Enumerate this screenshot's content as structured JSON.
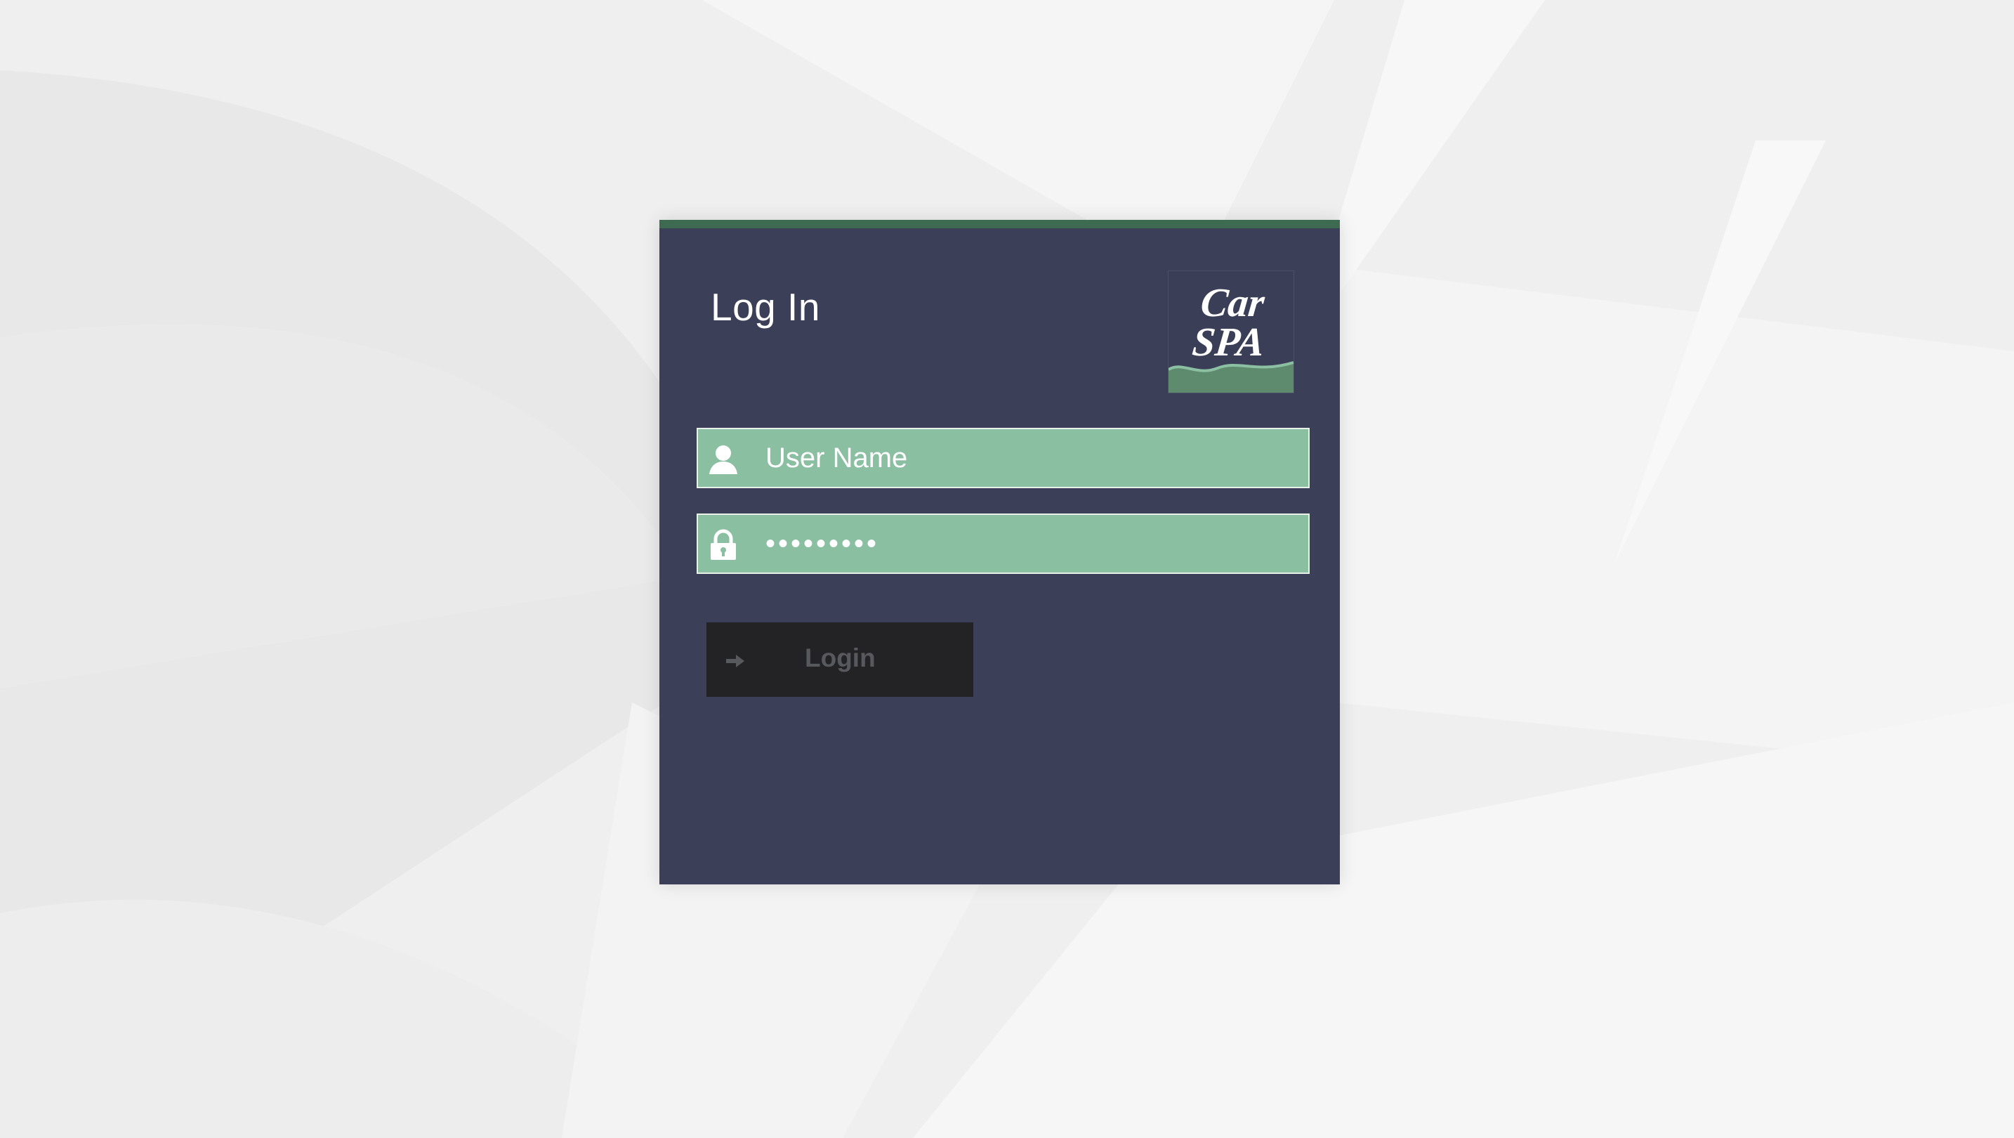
{
  "login_card": {
    "title": "Log In",
    "logo": {
      "line1": "Car",
      "line2": "SPA",
      "icon": "car-spa-logo"
    },
    "username": {
      "placeholder": "User Name",
      "value": "",
      "icon": "user-icon"
    },
    "password": {
      "value": "•••••••••",
      "icon": "lock-icon"
    },
    "login_button": {
      "label": "Login",
      "icon": "sign-in-arrow-icon"
    }
  },
  "colors": {
    "card_background": "#3b3f57",
    "accent_bar": "#3e6a52",
    "field_background": "#8bbfa2",
    "button_background": "#232325",
    "button_text": "#58595d"
  }
}
